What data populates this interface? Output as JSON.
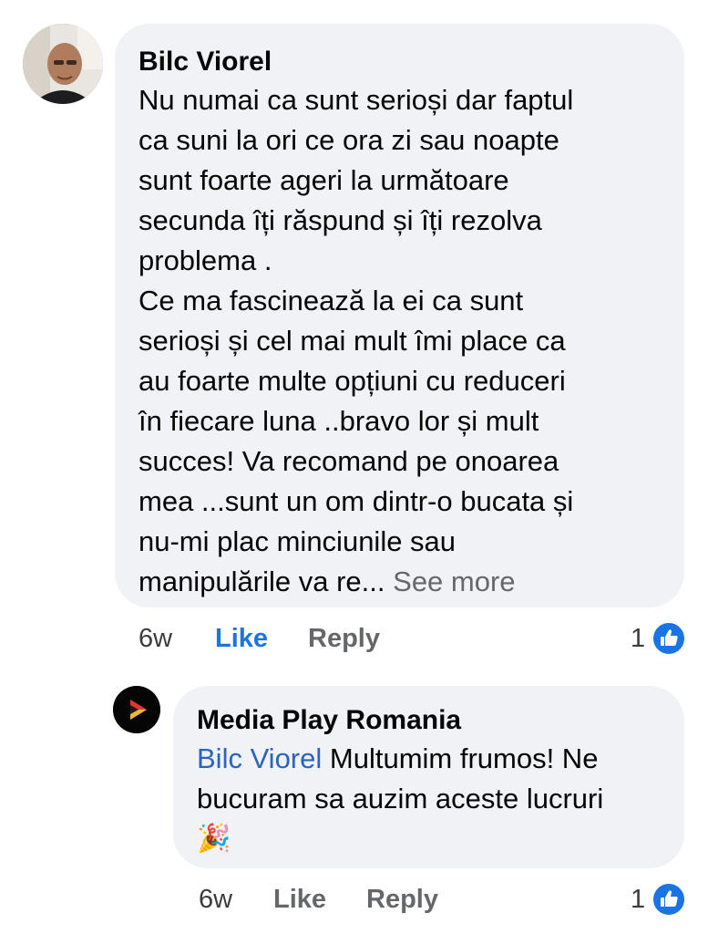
{
  "comment": {
    "author": "Bilc Viorel",
    "lines": [
      "Nu numai ca sunt serioși dar faptul",
      "ca suni la ori ce ora zi sau noapte",
      "sunt foarte ageri la următoare",
      "secunda îți răspund și îți rezolva",
      "problema .",
      "Ce ma fascinează la ei ca sunt",
      "serioși și cel mai mult îmi place ca",
      "au foarte multe opțiuni cu reduceri",
      "în fiecare luna ..bravo lor și mult",
      "succes! Va recomand pe onoarea",
      "mea ...sunt un om dintr-o bucata și",
      "nu-mi plac minciunile sau"
    ],
    "last_line": "manipulările va re...",
    "see_more": "See more",
    "time": "6w",
    "like_label": "Like",
    "reply_label": "Reply",
    "reaction_count": "1",
    "like_active_color": "#1b74e4"
  },
  "reply": {
    "author": "Media Play Romania",
    "mention": "Bilc Viorel",
    "text_line1": "Multumim frumos! Ne",
    "text_line2": "bucuram sa auzim aceste lucruri",
    "emoji": "🎉",
    "time": "6w",
    "like_label": "Like",
    "reply_label": "Reply",
    "reaction_count": "1"
  }
}
